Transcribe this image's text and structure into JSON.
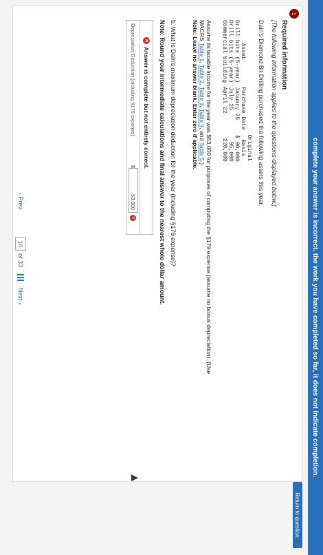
{
  "topbar": {
    "text": "complete your answer is incorrect. the work you have completed so far, it does not indicate completion."
  },
  "return_button": "Return to question",
  "badge": "1",
  "required": {
    "title": "Required information",
    "subtitle": "[The following information applies to the questions displayed below.]",
    "intro": "Dain's Diamond Bit Drilling purchased the following assets this year."
  },
  "assets": {
    "headers": [
      "Asset",
      "Purchase Date",
      "Original Basis"
    ],
    "rows": [
      [
        "Drill bits (5-year)",
        "January 25",
        "$ 90,000"
      ],
      [
        "Drill bits (5-year)",
        "July 25",
        "95,000"
      ],
      [
        "Commercial building",
        "April 22",
        "220,000"
      ]
    ]
  },
  "assume": {
    "text": "Assume its taxable income for the year was $53,000 for purposes of computing the §179 expense (assume no bonus depreciation). (Use MACRS",
    "links": [
      "Table 1",
      "Table 2",
      "Table 3",
      "Table 4",
      "Table 5"
    ],
    "note": "Note: Leave no answer blank. Enter zero if applicable."
  },
  "question": {
    "text": "b. What is Dain's maximum depreciation deduction for the year (including §179 expense)?",
    "note": "Note: Round your intermediate calculations and final answer to the nearest whole dollar amount."
  },
  "answer": {
    "status": "Answer is complete but not entirely correct.",
    "label": "Depreciation Deduction (including §179 expense)",
    "currency": "$",
    "value": "53,000"
  },
  "nav": {
    "prev": "Prev",
    "page": "16",
    "of": "of 33",
    "next": "Next"
  }
}
